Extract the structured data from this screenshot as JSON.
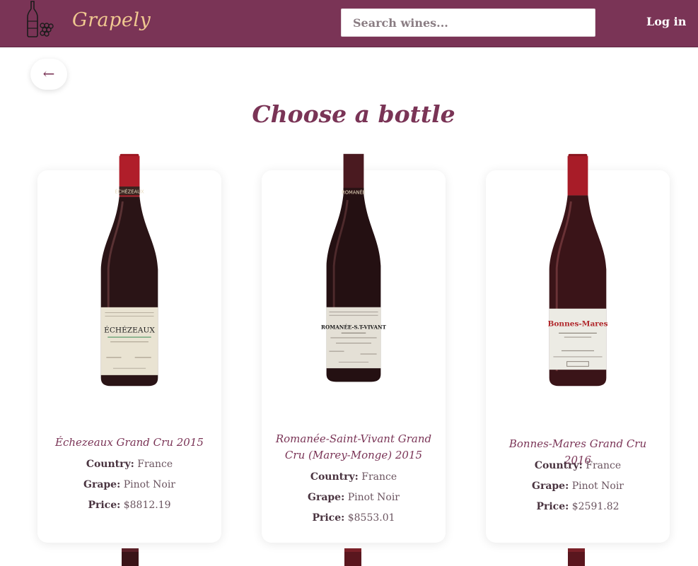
{
  "navbar": {
    "brand": "Grapely",
    "search_placeholder": "Search wines...",
    "login_label": "Log in"
  },
  "back_button": {
    "icon": "←"
  },
  "page": {
    "title": "Choose a bottle"
  },
  "labels": {
    "country": "Country:",
    "grape": "Grape:",
    "price": "Price:"
  },
  "wines": [
    {
      "name": "Échezeaux Grand Cru 2015",
      "country": "France",
      "grape": "Pinot Noir",
      "price": "$8812.19",
      "bottle_label": "ÉCHÉZEAUX",
      "capsule_text": "ÉCHÉZEAUX",
      "label_color": "#e9e3d2",
      "label_text_color": "#1e1e1e"
    },
    {
      "name": "Romanée-Saint-Vivant Grand Cru (Marey-Monge) 2015",
      "country": "France",
      "grape": "Pinot Noir",
      "price": "$8553.01",
      "bottle_label": "ROMANÉE-S.T-VIVANT",
      "capsule_text": "ROMANÉE",
      "label_color": "#e4e0d6",
      "label_text_color": "#1e1e1e"
    },
    {
      "name": "Bonnes-Mares Grand Cru 2016",
      "country": "France",
      "grape": "Pinot Noir",
      "price": "$2591.82",
      "bottle_label": "Bonnes-Mares",
      "capsule_text": "",
      "label_color": "#ecebe4",
      "label_text_color": "#b0262a"
    }
  ],
  "colors": {
    "navbar": "#7a3456",
    "brand": "#f0c890",
    "title": "#7a3456",
    "capsule_red": "#b01e2a",
    "capsule_dark": "#4a1a20"
  }
}
